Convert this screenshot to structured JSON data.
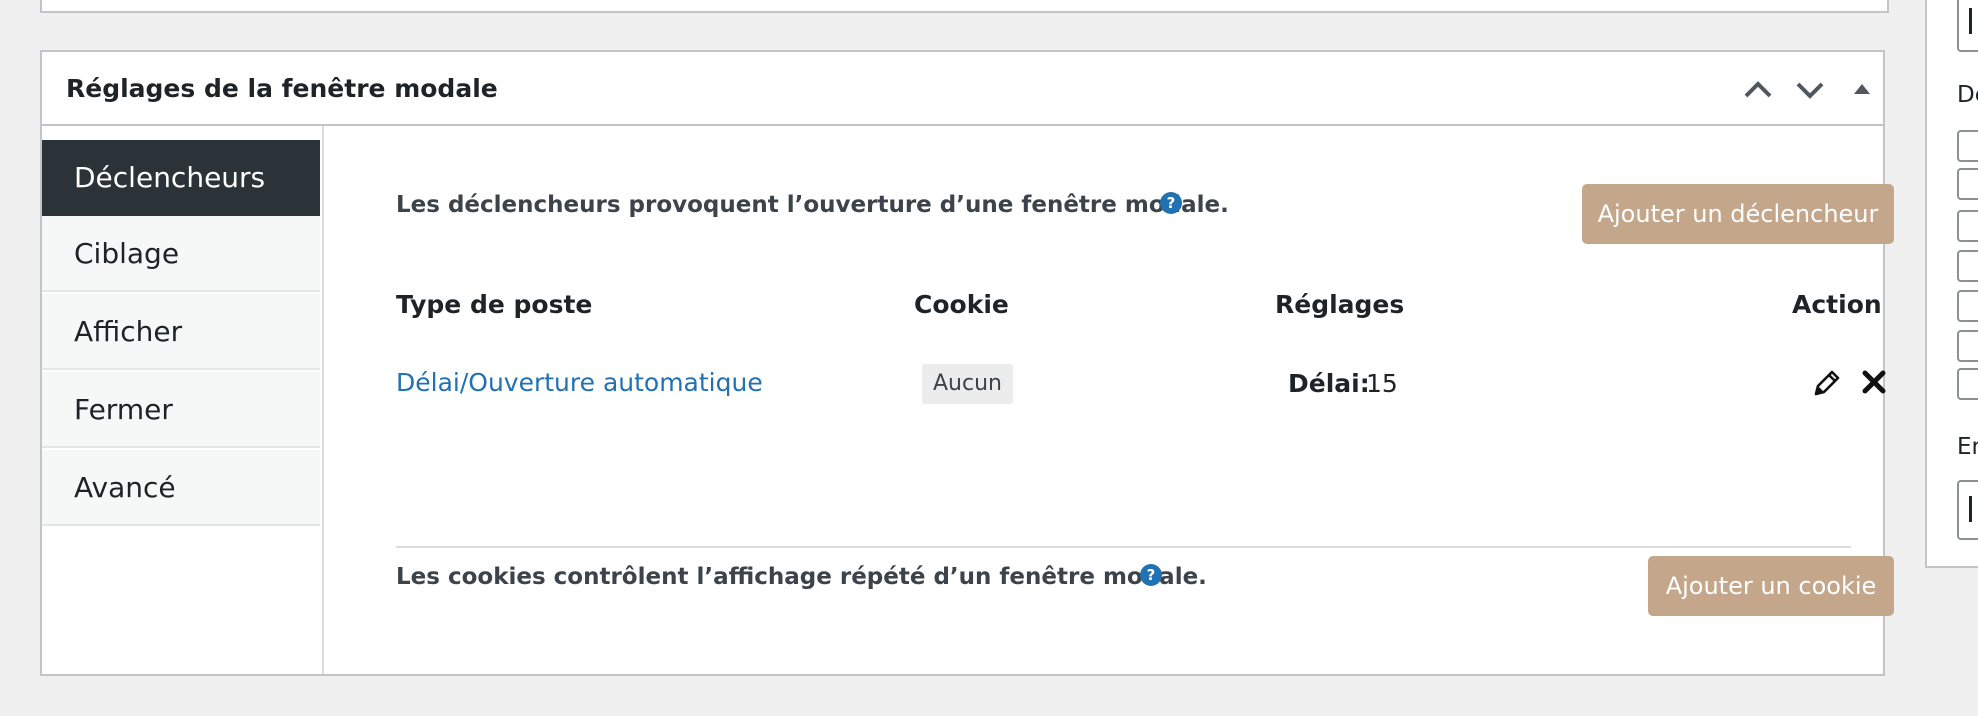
{
  "metabox": {
    "title": "Réglages de la fenêtre modale"
  },
  "tabs": [
    {
      "label": "Déclencheurs",
      "active": true
    },
    {
      "label": "Ciblage"
    },
    {
      "label": "Afficher"
    },
    {
      "label": "Fermer"
    },
    {
      "label": "Avancé"
    }
  ],
  "triggers": {
    "description": "Les déclencheurs provoquent l’ouverture d’une fenêtre modale.",
    "help_glyph": "?",
    "add_button": "Ajouter un déclencheur",
    "columns": [
      "Type de poste",
      "Cookie",
      "Réglages",
      "Action"
    ],
    "rows": [
      {
        "type": "Délai/Ouverture automatique",
        "cookie": "Aucun",
        "setting_label": "Délai:",
        "setting_value": "15"
      }
    ]
  },
  "cookies": {
    "description": "Les cookies contrôlent l’affichage répété d’un fenêtre modale.",
    "help_glyph": "?",
    "add_button": "Ajouter un cookie"
  },
  "sidebar": {
    "label_1": "De",
    "label_2": "En"
  },
  "colors": {
    "accent_button": "#c4a68b",
    "active_tab": "#2c3338",
    "link": "#2271b1"
  }
}
